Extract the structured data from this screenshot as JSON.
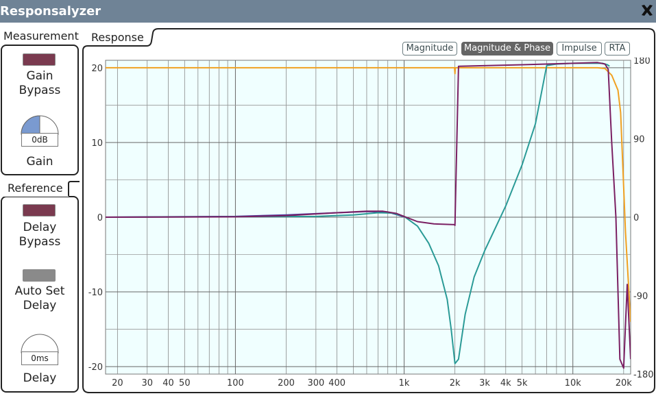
{
  "window": {
    "title": "Responsalyzer"
  },
  "measurement": {
    "legend": "Measurement",
    "gain_bypass": {
      "label1": "Gain",
      "label2": "Bypass",
      "on": true
    },
    "gain": {
      "value": "0dB",
      "label": "Gain",
      "level": 0.5
    }
  },
  "reference": {
    "legend": "Reference",
    "delay_bypass": {
      "label1": "Delay",
      "label2": "Bypass",
      "on": true
    },
    "auto_set_delay": {
      "label1": "Auto Set",
      "label2": "Delay",
      "on": false
    },
    "delay": {
      "value": "0ms",
      "label": "Delay",
      "level": 0.0
    }
  },
  "response": {
    "legend": "Response",
    "tabs": [
      "Magnitude",
      "Magnitude & Phase",
      "Impulse",
      "RTA"
    ],
    "active_tab": "Magnitude & Phase"
  },
  "colors": {
    "plot_bg": "#f0ffff",
    "magnitude_measured": "#7a1f62",
    "magnitude_reference": "#4b3aa0",
    "phase": "#2a9a96",
    "orange": "#f0a020"
  },
  "chart_data": {
    "type": "line",
    "x_scale": "log",
    "xlim": [
      17,
      22000
    ],
    "ylim_left": [
      -21,
      21
    ],
    "ylim_right": [
      -180,
      180
    ],
    "x_tick_labels": [
      "20",
      "30",
      "40",
      "50",
      "100",
      "200",
      "300",
      "400",
      "1k",
      "2k",
      "3k",
      "4k",
      "5k",
      "10k",
      "20k"
    ],
    "x_tick_values": [
      20,
      30,
      40,
      50,
      100,
      200,
      300,
      400,
      1000,
      2000,
      3000,
      4000,
      5000,
      10000,
      20000
    ],
    "y_tick_labels_left": [
      "20",
      "10",
      "0",
      "-10",
      "-20"
    ],
    "y_tick_values_left": [
      20,
      10,
      0,
      -10,
      -20
    ],
    "y_tick_labels_right": [
      "180",
      "90",
      "0",
      "-90",
      "-180"
    ],
    "y_tick_values_right": [
      180,
      90,
      0,
      -90,
      -180
    ],
    "grid": true,
    "series": [
      {
        "color": "#f0a020",
        "axis": "left",
        "points": [
          [
            17,
            20
          ],
          [
            1990,
            20
          ],
          [
            2000,
            19.2
          ],
          [
            2010,
            20
          ],
          [
            14000,
            20
          ],
          [
            15500,
            19.9
          ],
          [
            17000,
            19
          ],
          [
            18500,
            17
          ],
          [
            19200,
            14
          ],
          [
            20500,
            -2
          ],
          [
            22000,
            -14
          ]
        ]
      },
      {
        "color": "#4b3aa0",
        "axis": "left",
        "points": [
          [
            17,
            0
          ],
          [
            100,
            0.1
          ],
          [
            200,
            0.3
          ],
          [
            400,
            0.6
          ],
          [
            600,
            0.75
          ],
          [
            800,
            0.7
          ],
          [
            1000,
            0.05
          ]
        ]
      },
      {
        "color": "#2a9a96",
        "axis": "left",
        "points": [
          [
            17,
            0
          ],
          [
            300,
            0.1
          ],
          [
            500,
            0.3
          ],
          [
            700,
            0.6
          ],
          [
            850,
            0.55
          ],
          [
            1000,
            0.1
          ],
          [
            1200,
            -1.2
          ],
          [
            1400,
            -3.5
          ],
          [
            1600,
            -6.5
          ],
          [
            1800,
            -11
          ],
          [
            1900,
            -15
          ],
          [
            2000,
            -19.6
          ],
          [
            2100,
            -19
          ],
          [
            2300,
            -13
          ],
          [
            2600,
            -8
          ],
          [
            3000,
            -4.5
          ],
          [
            4000,
            1.5
          ],
          [
            5000,
            7
          ],
          [
            6000,
            12.5
          ],
          [
            7000,
            20.3
          ],
          [
            8000,
            20.5
          ],
          [
            10000,
            20.6
          ],
          [
            15000,
            20.6
          ],
          [
            16000,
            20.4
          ],
          [
            16500,
            20.2
          ]
        ]
      },
      {
        "color": "#7a1f62",
        "axis": "left",
        "points": [
          [
            17,
            0
          ],
          [
            100,
            0.05
          ],
          [
            200,
            0.2
          ],
          [
            400,
            0.6
          ],
          [
            600,
            0.8
          ],
          [
            750,
            0.8
          ],
          [
            900,
            0.5
          ],
          [
            1000,
            0.1
          ],
          [
            1200,
            -0.6
          ],
          [
            1500,
            -0.9
          ],
          [
            1990,
            -1
          ],
          [
            2000,
            -1.1
          ],
          [
            2100,
            20.2
          ],
          [
            5000,
            20.4
          ],
          [
            10000,
            20.6
          ],
          [
            14000,
            20.7
          ],
          [
            15500,
            20.5
          ],
          [
            16200,
            19.8
          ],
          [
            17000,
            10
          ],
          [
            18000,
            0
          ],
          [
            19000,
            -19
          ],
          [
            20000,
            -20.2
          ],
          [
            21000,
            -9
          ],
          [
            22000,
            -19
          ]
        ]
      }
    ]
  }
}
